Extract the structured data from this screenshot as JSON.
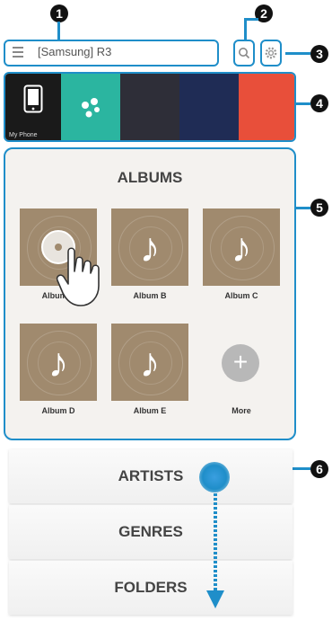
{
  "callouts": [
    "1",
    "2",
    "3",
    "4",
    "5",
    "6"
  ],
  "header": {
    "device_name": "[Samsung] R3",
    "menu_icon": "hamburger-menu-icon",
    "search_icon": "search-icon",
    "settings_icon": "gear-icon"
  },
  "sources": [
    {
      "label": "My Phone",
      "color": "#1a1a1a"
    },
    {
      "label": "",
      "color": "#2bb5a0"
    },
    {
      "label": "",
      "color": "#2e2e38"
    },
    {
      "label": "",
      "color": "#1f2c55"
    },
    {
      "label": "",
      "color": "#e84f3a"
    }
  ],
  "albums": {
    "title": "ALBUMS",
    "items": [
      {
        "label": "Album A"
      },
      {
        "label": "Album B"
      },
      {
        "label": "Album C"
      },
      {
        "label": "Album D"
      },
      {
        "label": "Album E"
      }
    ],
    "more_label": "More"
  },
  "categories": [
    "ARTISTS",
    "GENRES",
    "FOLDERS"
  ],
  "colors": {
    "accent": "#1f8ec9",
    "tile": "#a08a6e",
    "callout": "#111111"
  }
}
